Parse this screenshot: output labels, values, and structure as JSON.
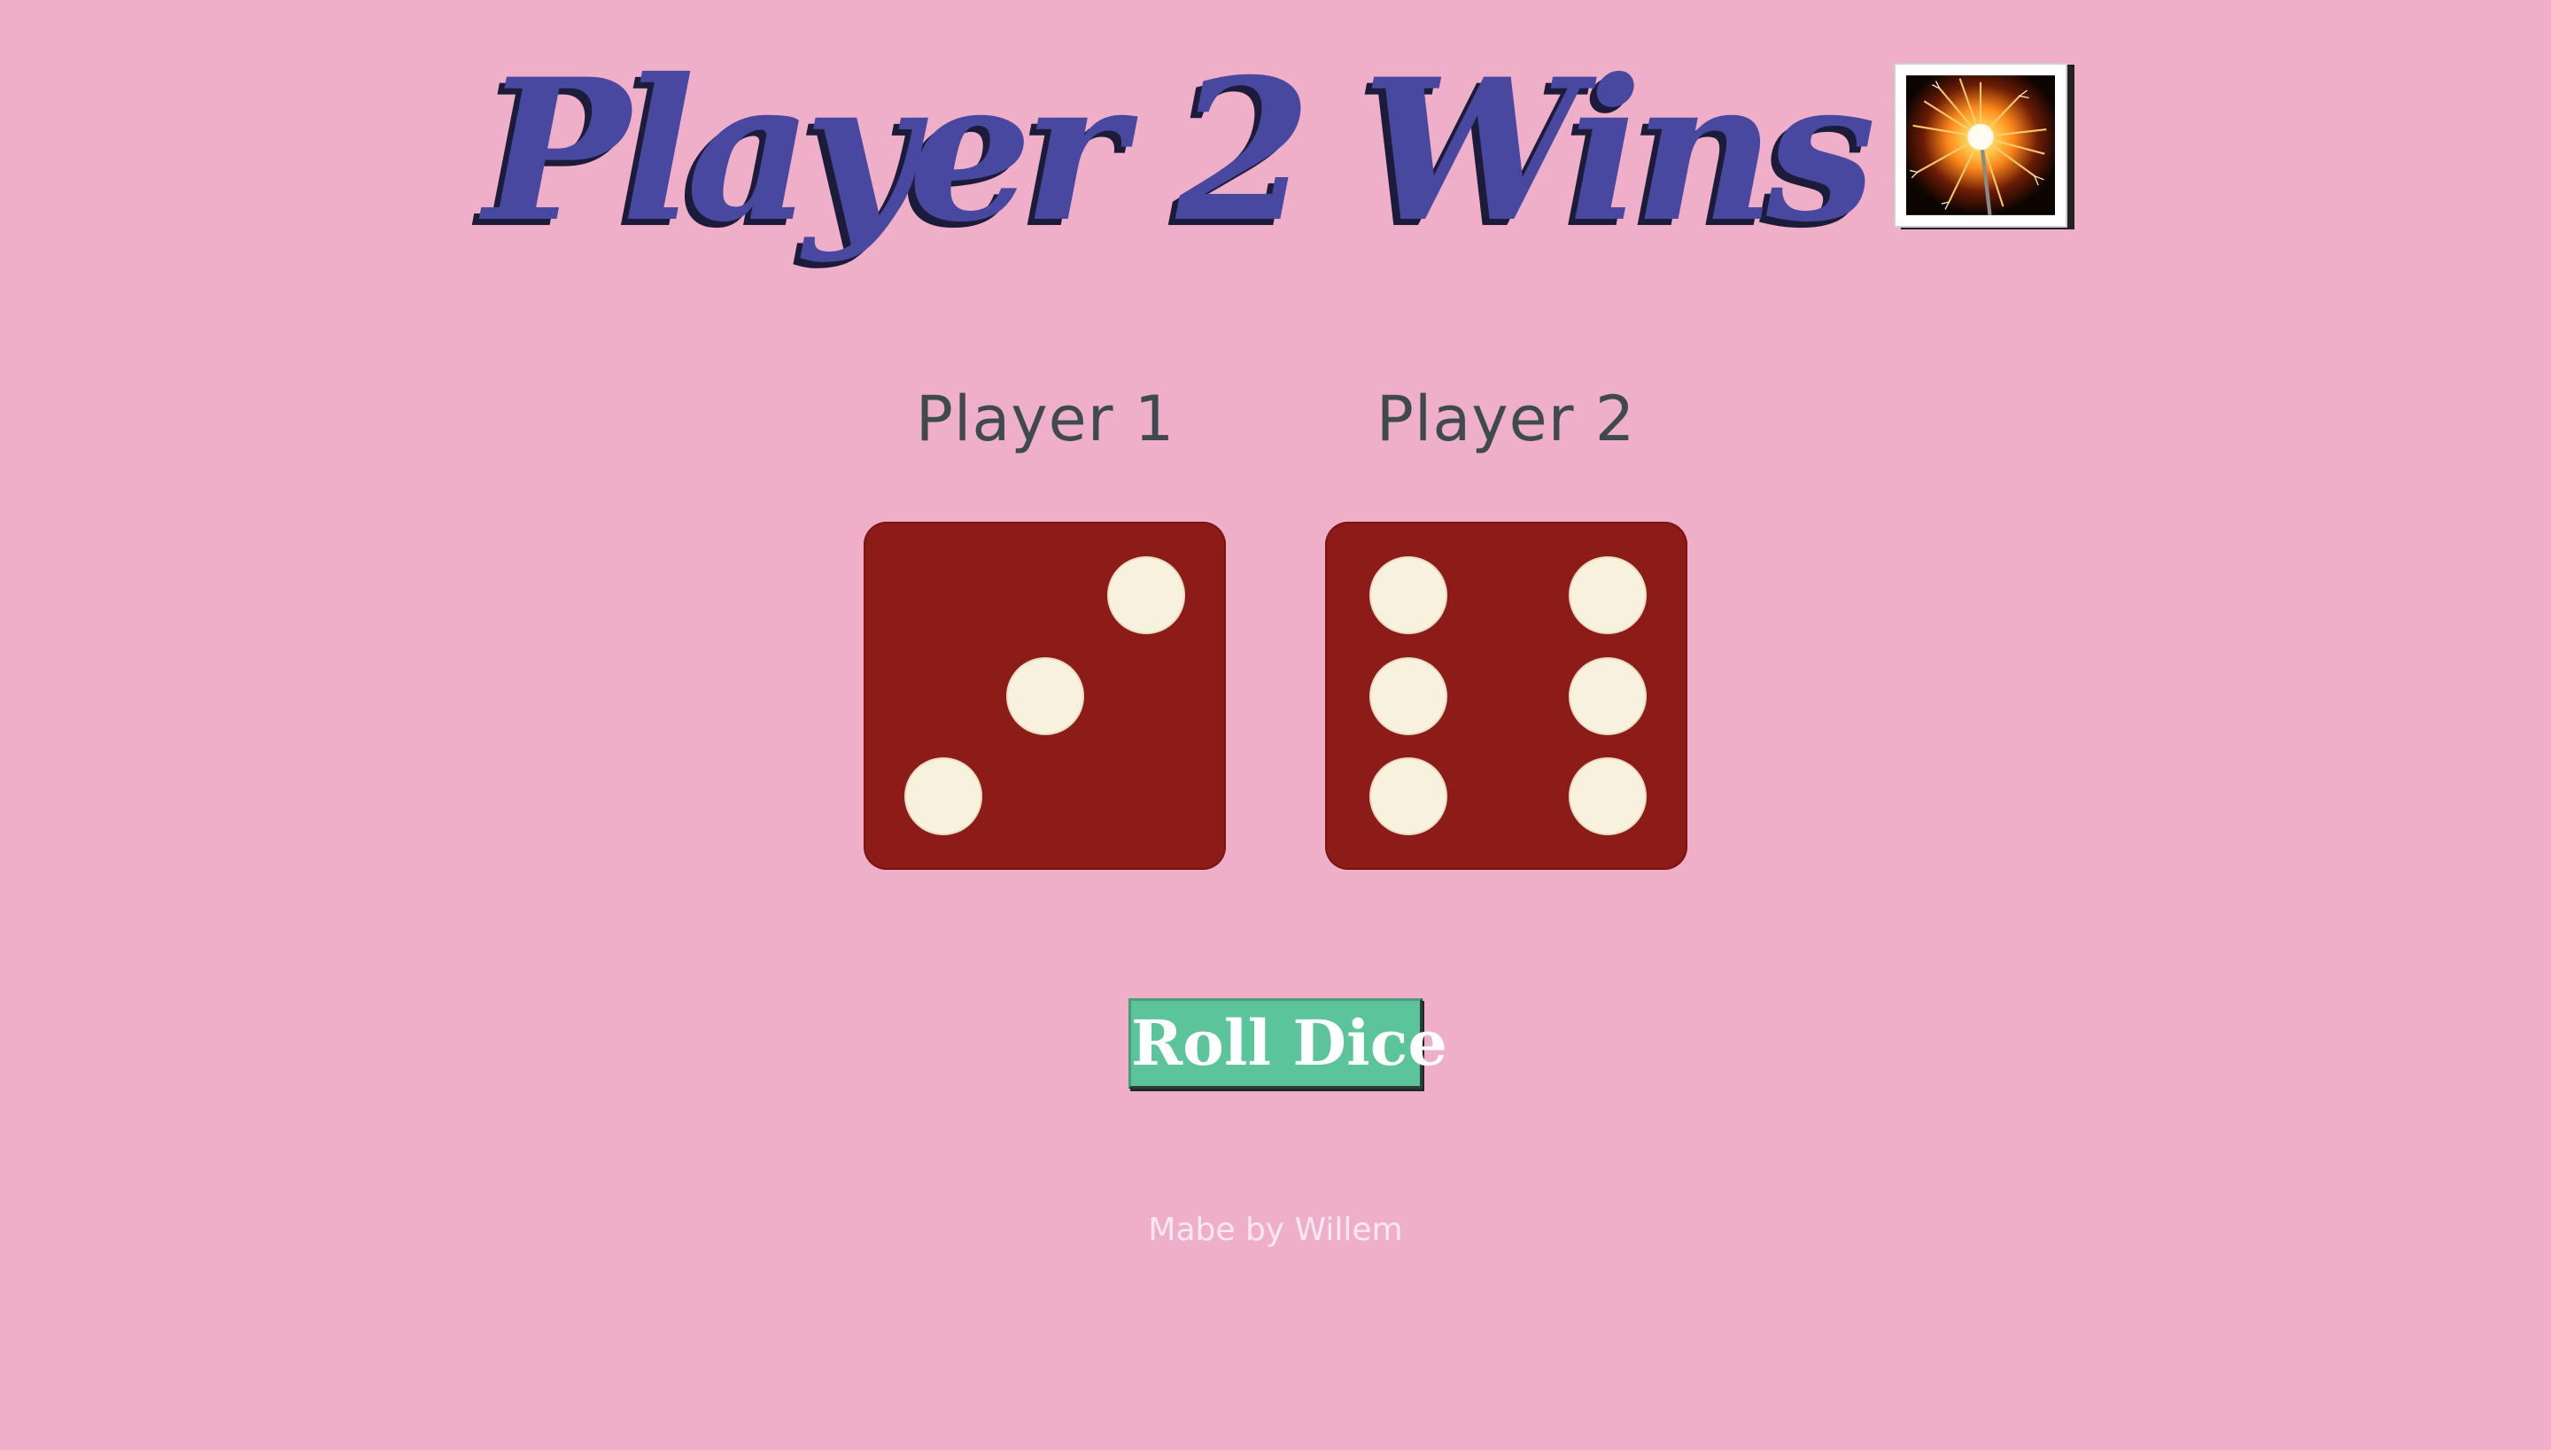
{
  "title": {
    "text": "Player 2 Wins",
    "icon": "sparkler-firework-icon"
  },
  "players": [
    {
      "label": "Player 1",
      "die_value": 3
    },
    {
      "label": "Player 2",
      "die_value": 6
    }
  ],
  "button": {
    "label": "Roll Dice"
  },
  "footer": {
    "text": "Mabe by Willem"
  },
  "colors": {
    "background": "#EFAFC9",
    "title": "#4848A0",
    "die": "#8D1C19",
    "pip": "#F7F1DE",
    "button": "#5CC49B",
    "label": "#3F4A4F"
  }
}
